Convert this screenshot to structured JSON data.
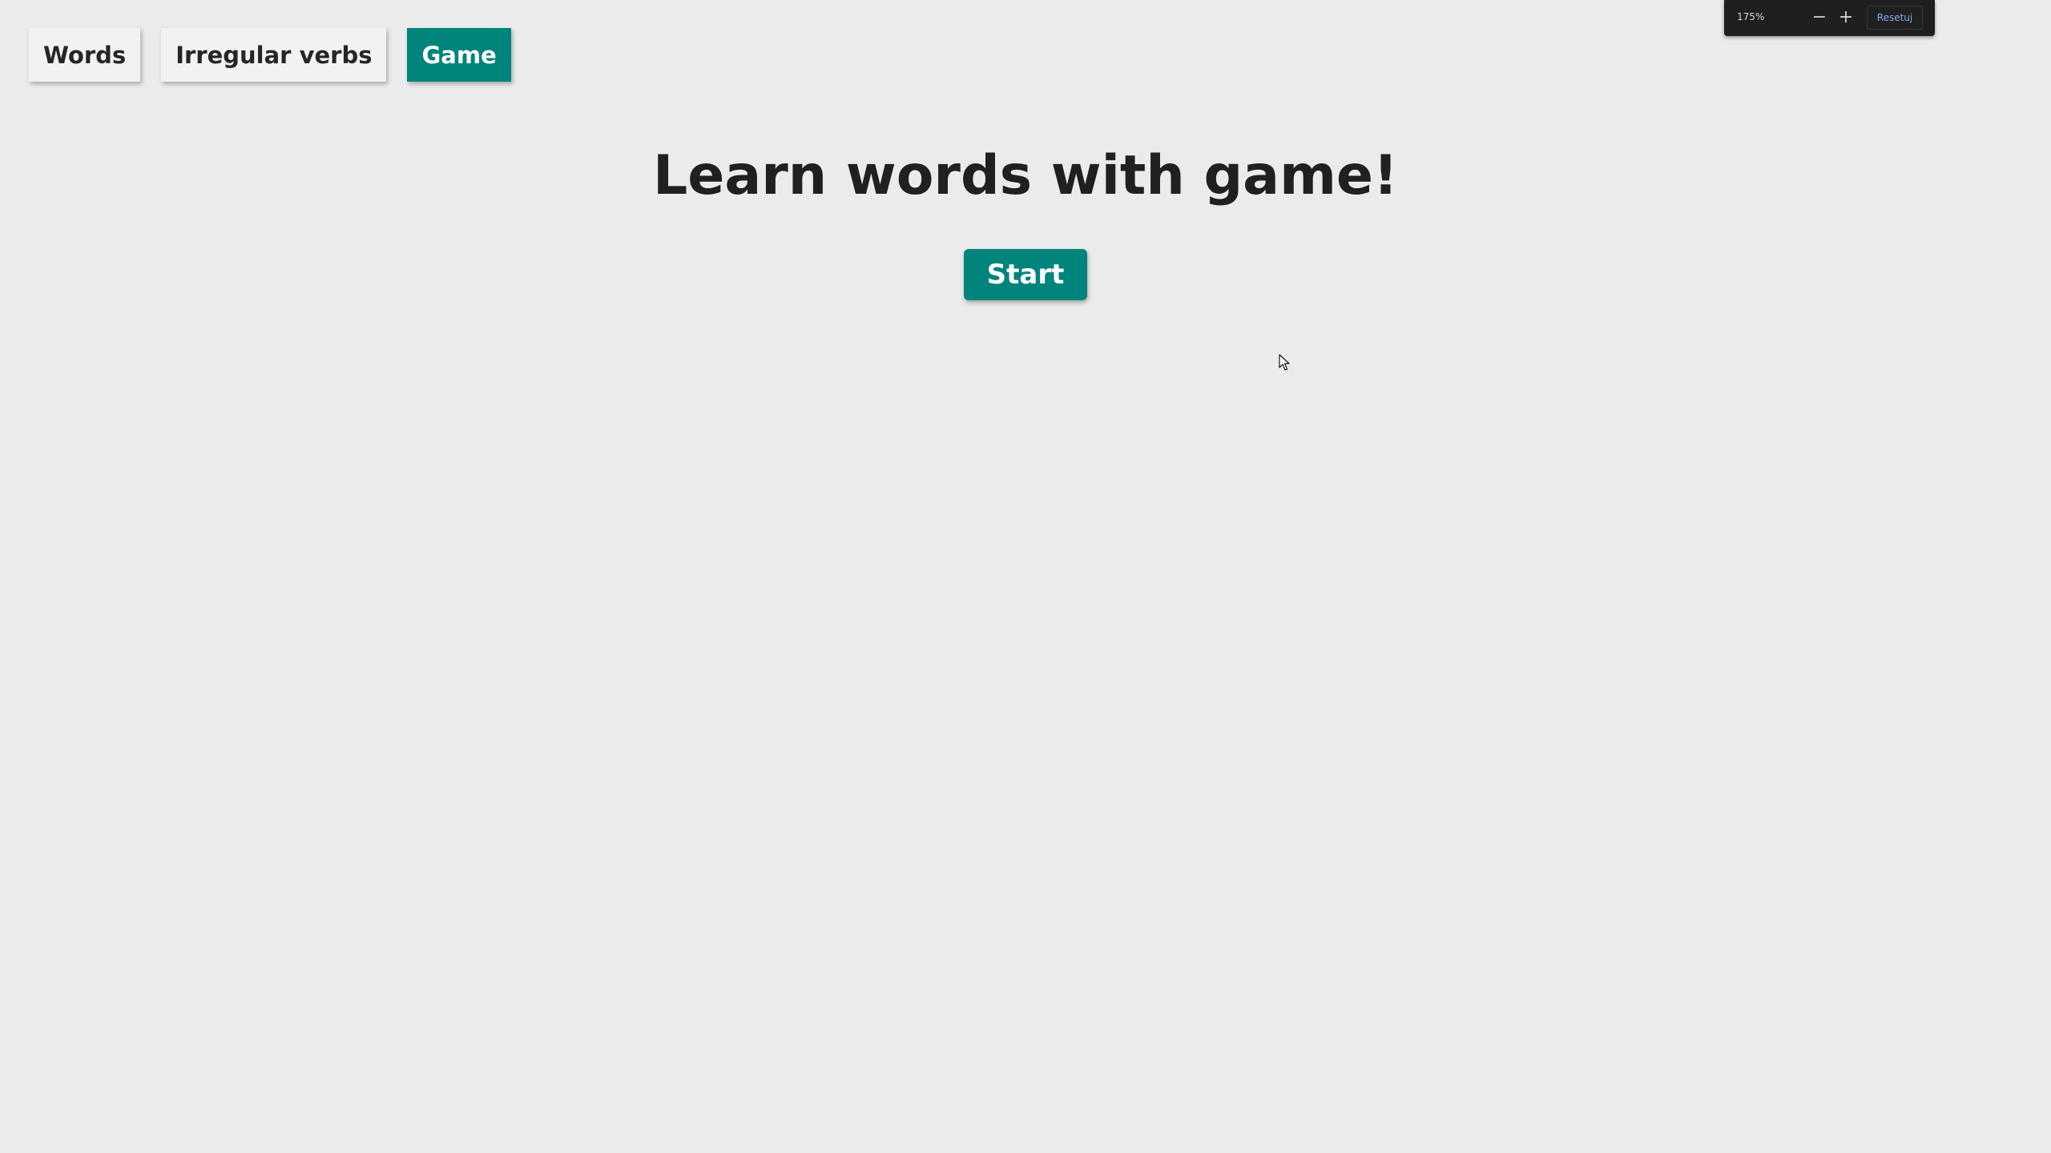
{
  "nav": {
    "items": [
      {
        "label": "Words"
      },
      {
        "label": "Irregular verbs"
      },
      {
        "label": "Game"
      }
    ],
    "active": "Game"
  },
  "main": {
    "heading": "Learn words with game!",
    "start_label": "Start"
  },
  "zoom_bar": {
    "level": "175%",
    "minus_label": "−",
    "plus_label": "+",
    "reset_label": "Resetuj"
  },
  "colors": {
    "accent": "#00847c",
    "background": "#ebebeb",
    "text": "#202020"
  }
}
